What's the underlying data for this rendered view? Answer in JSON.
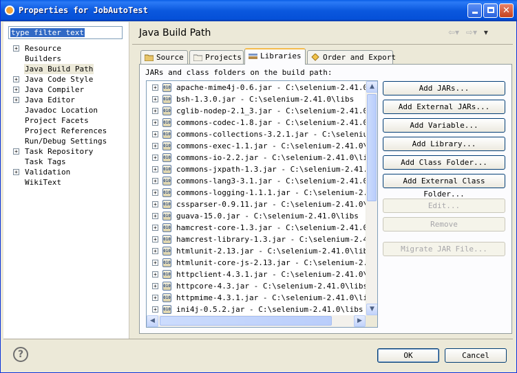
{
  "window": {
    "title": "Properties for JobAutoTest",
    "minimize": "minimize",
    "maximize": "maximize",
    "close": "close"
  },
  "filter": {
    "value": "type filter text"
  },
  "tree": [
    {
      "label": "Resource",
      "expandable": true
    },
    {
      "label": "Builders",
      "expandable": false
    },
    {
      "label": "Java Build Path",
      "expandable": false,
      "selected": true
    },
    {
      "label": "Java Code Style",
      "expandable": true
    },
    {
      "label": "Java Compiler",
      "expandable": true
    },
    {
      "label": "Java Editor",
      "expandable": true
    },
    {
      "label": "Javadoc Location",
      "expandable": false
    },
    {
      "label": "Project Facets",
      "expandable": false
    },
    {
      "label": "Project References",
      "expandable": false
    },
    {
      "label": "Run/Debug Settings",
      "expandable": false
    },
    {
      "label": "Task Repository",
      "expandable": true
    },
    {
      "label": "Task Tags",
      "expandable": false
    },
    {
      "label": "Validation",
      "expandable": true
    },
    {
      "label": "WikiText",
      "expandable": false
    }
  ],
  "page": {
    "title": "Java Build Path"
  },
  "tabs": [
    {
      "label": "Source"
    },
    {
      "label": "Projects"
    },
    {
      "label": "Libraries",
      "active": true
    },
    {
      "label": "Order and Export"
    }
  ],
  "libraries": {
    "label": "JARs and class folders on the build path:",
    "jars": [
      "apache-mime4j-0.6.jar - C:\\selenium-2.41.0\\lib",
      "bsh-1.3.0.jar - C:\\selenium-2.41.0\\libs",
      "cglib-nodep-2.1_3.jar - C:\\selenium-2.41.0\\lib",
      "commons-codec-1.8.jar - C:\\selenium-2.41.0\\lib",
      "commons-collections-3.2.1.jar - C:\\selenium-2.",
      "commons-exec-1.1.jar - C:\\selenium-2.41.0\\libs",
      "commons-io-2.2.jar - C:\\selenium-2.41.0\\libs",
      "commons-jxpath-1.3.jar - C:\\selenium-2.41.0\\lib",
      "commons-lang3-3.1.jar - C:\\selenium-2.41.0\\lib",
      "commons-logging-1.1.1.jar - C:\\selenium-2.41.0",
      "cssparser-0.9.11.jar - C:\\selenium-2.41.0\\libs",
      "guava-15.0.jar - C:\\selenium-2.41.0\\libs",
      "hamcrest-core-1.3.jar - C:\\selenium-2.41.0\\lib",
      "hamcrest-library-1.3.jar - C:\\selenium-2.41.0\\",
      "htmlunit-2.13.jar - C:\\selenium-2.41.0\\libs",
      "htmlunit-core-js-2.13.jar - C:\\selenium-2.41.0",
      "httpclient-4.3.1.jar - C:\\selenium-2.41.0\\lib",
      "httpcore-4.3.jar - C:\\selenium-2.41.0\\libs",
      "httpmime-4.3.1.jar - C:\\selenium-2.41.0\\libs",
      "ini4j-0.5.2.jar - C:\\selenium-2.41.0\\libs"
    ]
  },
  "buttons": {
    "add_jars": "Add JARs...",
    "add_external_jars": "Add External JARs...",
    "add_variable": "Add Variable...",
    "add_library": "Add Library...",
    "add_class_folder": "Add Class Folder...",
    "add_external_class_folder": "Add External Class Folder...",
    "edit": "Edit...",
    "remove": "Remove",
    "migrate": "Migrate JAR File..."
  },
  "dialog": {
    "ok": "OK",
    "cancel": "Cancel",
    "help": "?"
  }
}
